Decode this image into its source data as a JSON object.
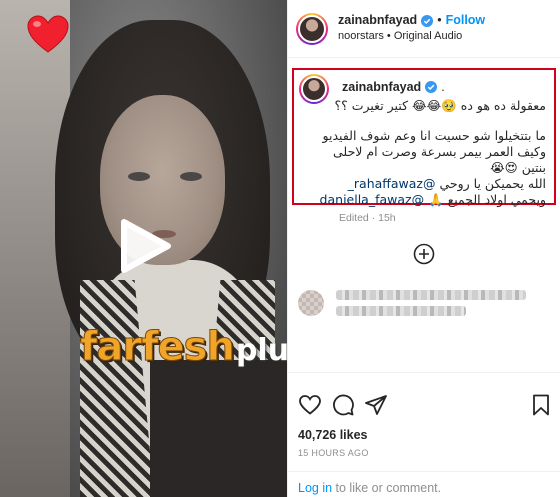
{
  "post": {
    "username": "zainabnfayad",
    "follow_label": "Follow",
    "separator": "•",
    "audio_line": "noorstars • Original Audio"
  },
  "caption": {
    "username": "zainabnfayad",
    "period": ".",
    "lines": [
      "معقولة ده هو ده 🥹😂😂 كتير تغيرت ؟؟",
      "",
      "ما بتتخيلوا شو حسيت انا وعم شوف الفيديو",
      "وكيف العمر بيمر بسرعة وصرت ام لاحلى",
      "بنتين 😍😭"
    ],
    "mention_line_1_text": "الله يحميكن يا روحي",
    "mention_1": "@rahaffawaz_",
    "mention_line_2_text": "ويحمي اولاد الجميع 🙏",
    "mention_2": "@daniella_fawaz",
    "edited": "Edited · 15h"
  },
  "engagement": {
    "likes": "40,726 likes",
    "time": "15 HOURS AGO"
  },
  "footer": {
    "login_link": "Log in",
    "login_rest": " to like or comment."
  },
  "watermark": {
    "main": "farfesh",
    "suffix": "plus.com"
  },
  "icons": {
    "heart_sticker": "heart-icon",
    "play": "play-icon",
    "verified": "verified-badge-icon",
    "add_comment": "plus-circle-icon",
    "like": "heart-outline-icon",
    "comment": "comment-icon",
    "share": "send-icon",
    "save": "bookmark-icon"
  },
  "colors": {
    "accent": "#0095f6",
    "highlight_border": "#d0021b",
    "mention": "#00376b",
    "watermark": "#f0a52a"
  }
}
